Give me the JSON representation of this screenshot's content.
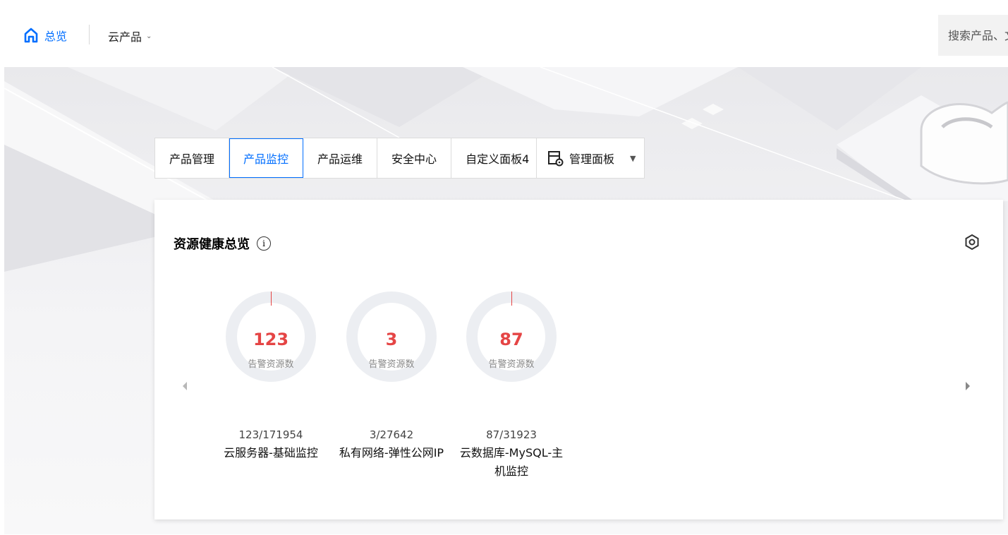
{
  "nav": {
    "home_label": "总览",
    "products_label": "云产品",
    "search_placeholder": "搜索产品、文档"
  },
  "tabs": [
    {
      "label": "产品管理",
      "active": false
    },
    {
      "label": "产品监控",
      "active": true
    },
    {
      "label": "产品运维",
      "active": false
    },
    {
      "label": "安全中心",
      "active": false
    },
    {
      "label": "自定义面板4",
      "active": false
    }
  ],
  "manage_panel": {
    "label": "管理面板",
    "icon": "dashboard-settings-icon"
  },
  "card": {
    "title": "资源健康总览",
    "info_icon": "info-icon",
    "settings_icon": "settings-icon",
    "items": [
      {
        "count": "123",
        "count_label": "告警资源数",
        "ratio": "123/171954",
        "name": "云服务器-基础监控"
      },
      {
        "count": "3",
        "count_label": "告警资源数",
        "ratio": "3/27642",
        "name": "私有网络-弹性公网IP"
      },
      {
        "count": "87",
        "count_label": "告警资源数",
        "ratio": "87/31923",
        "name": "云数据库-MySQL-主机监控"
      }
    ]
  },
  "colors": {
    "accent": "#006eff",
    "alert": "#e54545",
    "ring_track": "#eceef2"
  }
}
